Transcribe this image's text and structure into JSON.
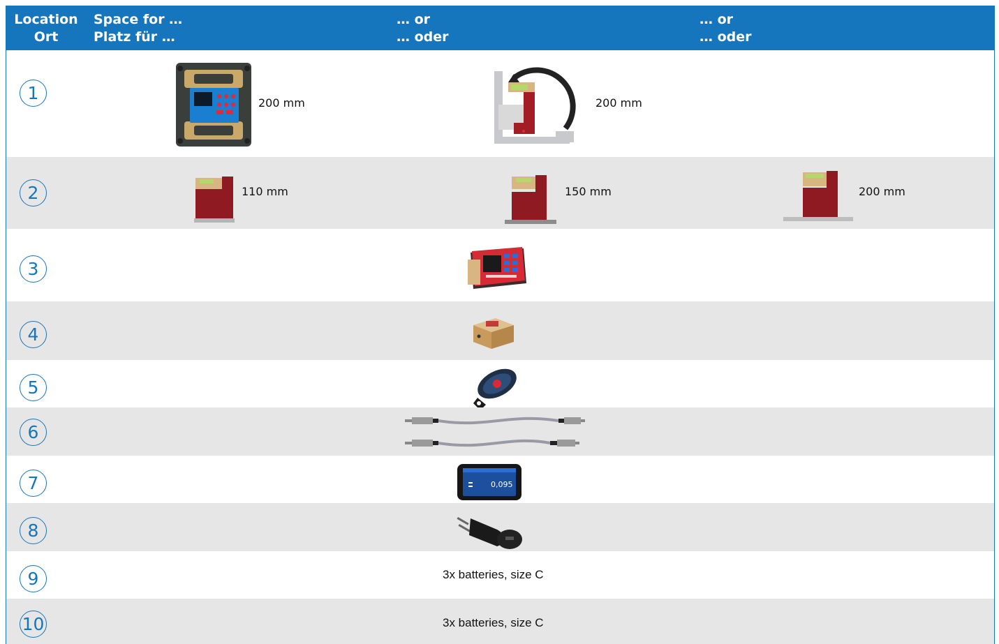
{
  "header": {
    "col_location": [
      "Location",
      "Ort"
    ],
    "col_space": [
      "Space for …",
      "Platz für …"
    ],
    "col_or1": [
      "… or",
      "… oder"
    ],
    "col_or2": [
      "… or",
      "… oder"
    ]
  },
  "rows": [
    {
      "num": "1",
      "items": [
        {
          "icon": "cyclops-block-level-icon",
          "label": "200 mm"
        },
        {
          "icon": "magnetic-angle-level-icon",
          "label": "200 mm"
        }
      ]
    },
    {
      "num": "2",
      "items": [
        {
          "icon": "small-precision-level-110-icon",
          "label": "110 mm"
        },
        {
          "icon": "precision-level-150-icon",
          "label": "150 mm"
        },
        {
          "icon": "precision-level-200-icon",
          "label": "200 mm"
        }
      ]
    },
    {
      "num": "3",
      "items": [
        {
          "icon": "readout-display-unit-icon"
        }
      ]
    },
    {
      "num": "4",
      "items": [
        {
          "icon": "wireless-module-icon"
        }
      ]
    },
    {
      "num": "5",
      "items": [
        {
          "icon": "remote-key-fob-icon"
        }
      ]
    },
    {
      "num": "6",
      "items": [
        {
          "icon": "connection-cables-icon"
        }
      ]
    },
    {
      "num": "7",
      "items": [
        {
          "icon": "smartphone-display-icon",
          "screen_value": "0,095"
        }
      ]
    },
    {
      "num": "8",
      "items": [
        {
          "icon": "usb-charger-icon"
        }
      ]
    },
    {
      "num": "9",
      "items": [
        {
          "label": "3x batteries, size C"
        }
      ]
    },
    {
      "num": "10",
      "items": [
        {
          "label": "3x batteries, size C"
        }
      ]
    }
  ],
  "colors": {
    "header_bg": "#1676bd",
    "row_shade": "#e6e6e6",
    "bullet": "#1676bd"
  }
}
